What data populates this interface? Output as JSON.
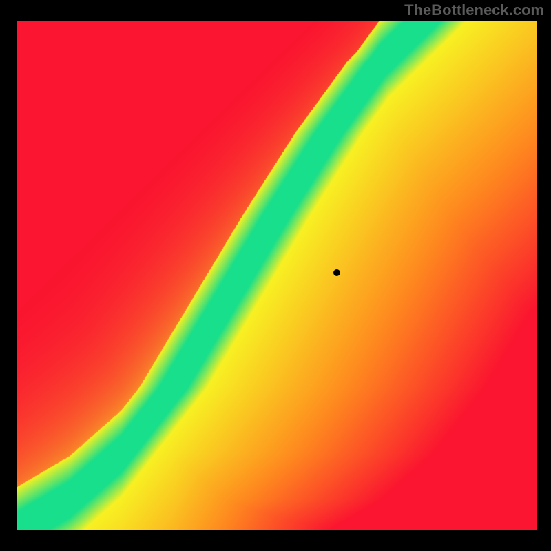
{
  "watermark": "TheBottleneck.com",
  "chart_data": {
    "type": "heatmap",
    "title": "",
    "xlabel": "",
    "ylabel": "",
    "xlim": [
      0,
      1
    ],
    "ylim": [
      0,
      1
    ],
    "crosshair": {
      "x": 0.615,
      "y": 0.505
    },
    "marker": {
      "x": 0.615,
      "y": 0.505
    },
    "color_stops": {
      "red": "#fb1530",
      "orange": "#ff8a1f",
      "yellow": "#f8f123",
      "green": "#18df8c"
    },
    "ridge": {
      "description": "Optimal-match diagonal band where GPU/CPU balance is ideal; green along curve, yellow near, orange/red far",
      "curve_points": [
        {
          "x": 0.0,
          "y": 0.0
        },
        {
          "x": 0.1,
          "y": 0.06
        },
        {
          "x": 0.2,
          "y": 0.15
        },
        {
          "x": 0.3,
          "y": 0.28
        },
        {
          "x": 0.4,
          "y": 0.45
        },
        {
          "x": 0.5,
          "y": 0.62
        },
        {
          "x": 0.6,
          "y": 0.78
        },
        {
          "x": 0.7,
          "y": 0.92
        },
        {
          "x": 0.78,
          "y": 1.0
        }
      ],
      "green_halfwidth": 0.035,
      "yellow_halfwidth": 0.085
    }
  }
}
